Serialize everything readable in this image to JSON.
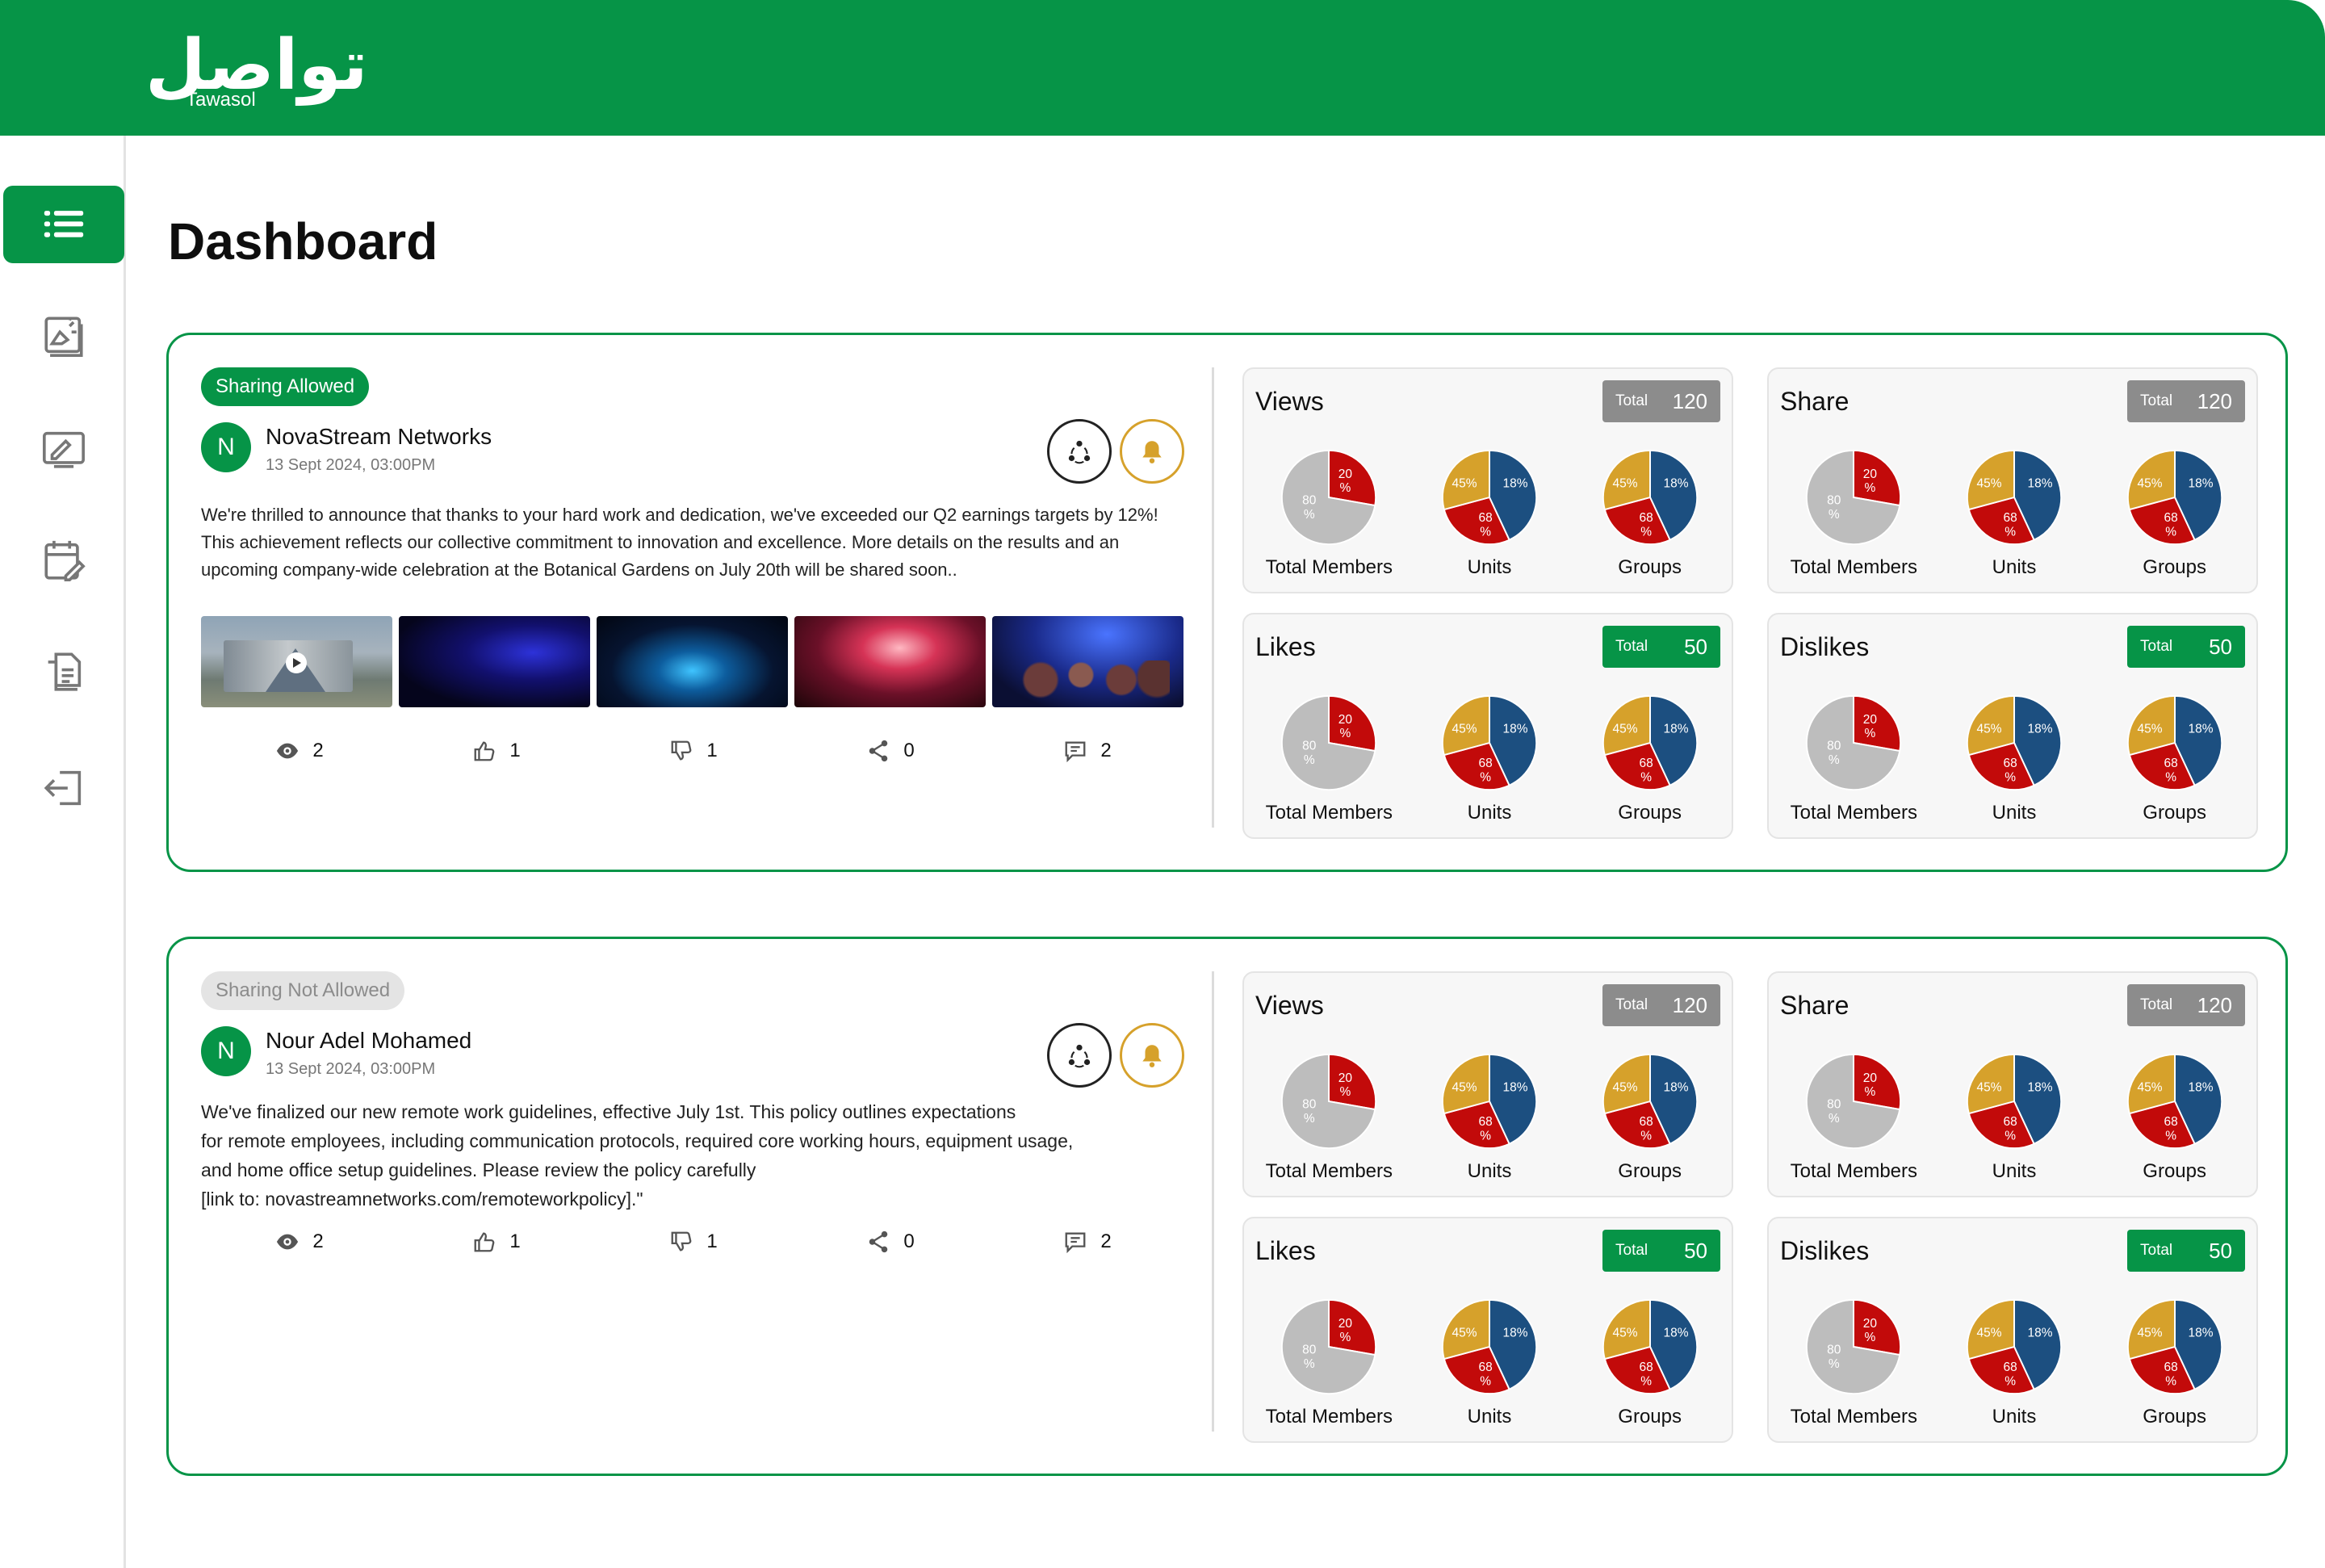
{
  "app": {
    "logo_arabic": "تواصل",
    "logo_english": "Tawasol"
  },
  "page_title": "Dashboard",
  "sidebar": [
    {
      "icon": "list-icon",
      "active": true
    },
    {
      "icon": "announcement-icon"
    },
    {
      "icon": "signature-icon"
    },
    {
      "icon": "calendar-edit-icon"
    },
    {
      "icon": "documents-icon"
    },
    {
      "icon": "logout-icon"
    }
  ],
  "posts": [
    {
      "sharing": "Sharing Allowed",
      "avatar_letter": "N",
      "author": "NovaStream Networks",
      "date": "13 Sept 2024, 03:00PM",
      "text": "We're thrilled to announce that thanks to your hard work and dedication, we've exceeded our Q2 earnings targets by 12%! This achievement reflects our collective commitment to innovation and excellence. More details on the results and an upcoming company-wide celebration at the Botanical Gardens on July 20th will be shared soon..",
      "stats": {
        "views": "2",
        "likes": "1",
        "dislikes": "1",
        "shares": "0",
        "comments": "2"
      },
      "metrics": [
        {
          "title": "Views",
          "total_label": "Total",
          "total": "120",
          "total_color": "#8c8c8c"
        },
        {
          "title": "Share",
          "total_label": "Total",
          "total": "120",
          "total_color": "#8c8c8c"
        },
        {
          "title": "Likes",
          "total_label": "Total",
          "total": "50",
          "total_color": "#069447"
        },
        {
          "title": "Dislikes",
          "total_label": "Total",
          "total": "50",
          "total_color": "#069447"
        }
      ]
    },
    {
      "sharing": "Sharing Not Allowed",
      "avatar_letter": "N",
      "author": "Nour Adel Mohamed",
      "date": "13 Sept 2024, 03:00PM",
      "text": "We've finalized our new remote work guidelines, effective July 1st. This policy outlines expectations\n for remote employees, including communication protocols, required core working hours, equipment usage,\nand home office setup guidelines. Please review the policy carefully\n[link to: novastreamnetworks.com/remoteworkpolicy].\"",
      "stats": {
        "views": "2",
        "likes": "1",
        "dislikes": "1",
        "shares": "0",
        "comments": "2"
      },
      "metrics": [
        {
          "title": "Views",
          "total_label": "Total",
          "total": "120",
          "total_color": "#8c8c8c"
        },
        {
          "title": "Share",
          "total_label": "Total",
          "total": "120",
          "total_color": "#8c8c8c"
        },
        {
          "title": "Likes",
          "total_label": "Total",
          "total": "50",
          "total_color": "#069447"
        },
        {
          "title": "Dislikes",
          "total_label": "Total",
          "total": "50",
          "total_color": "#069447"
        }
      ]
    }
  ],
  "pie_captions": [
    "Total Members",
    "Units",
    "Groups"
  ],
  "members_pie": {
    "major": "80 %",
    "minor": "20 %"
  },
  "segment_pie": {
    "a": "45%",
    "b": "18%",
    "c": "68 %"
  },
  "colors": {
    "brand": "#069447",
    "red": "#c20a0a",
    "blue": "#1c4f80",
    "gold": "#d6a12b",
    "gray": "#bdbdbd"
  }
}
